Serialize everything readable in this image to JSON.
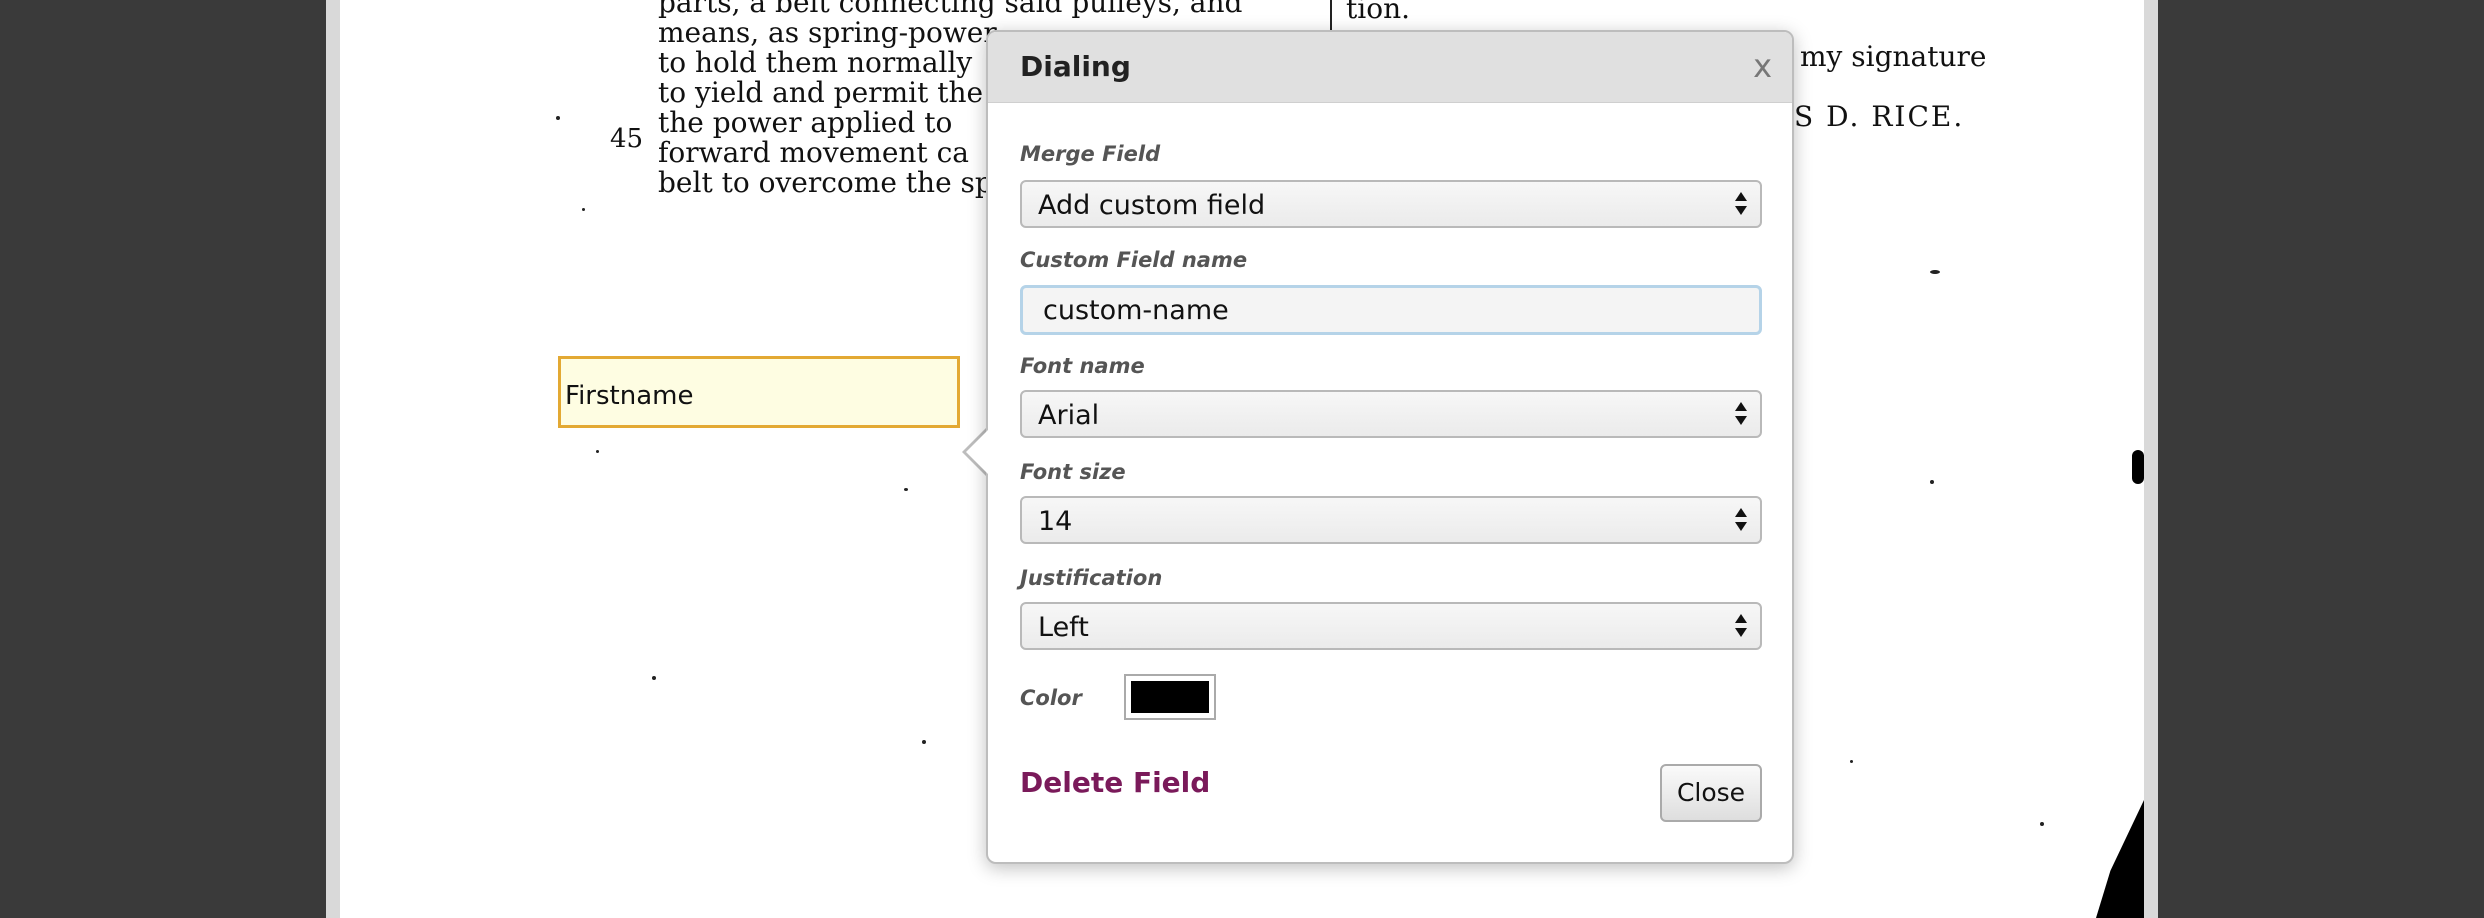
{
  "document": {
    "left_column_lines": [
      "parts, a belt connecting said pulleys, and",
      "means, as spring-power",
      "to hold them normally",
      "to yield and permit the",
      "the power applied to",
      "forward movement ca",
      "belt to overcome the spr"
    ],
    "right_column_lines": [
      "tion.",
      "my signature",
      "S D. RICE."
    ],
    "line_number": "45"
  },
  "merge_field_box": {
    "label": "Firstname"
  },
  "dialog": {
    "title": "Dialing",
    "close_x": "x",
    "merge_field_label": "Merge Field",
    "merge_field_value": "Add custom field",
    "custom_field_name_label": "Custom Field name",
    "custom_field_name_value": "custom-name",
    "font_name_label": "Font name",
    "font_name_value": "Arial",
    "font_size_label": "Font size",
    "font_size_value": "14",
    "justification_label": "Justification",
    "justification_value": "Left",
    "color_label": "Color",
    "color_value": "#000000",
    "delete_label": "Delete Field",
    "close_label": "Close"
  }
}
